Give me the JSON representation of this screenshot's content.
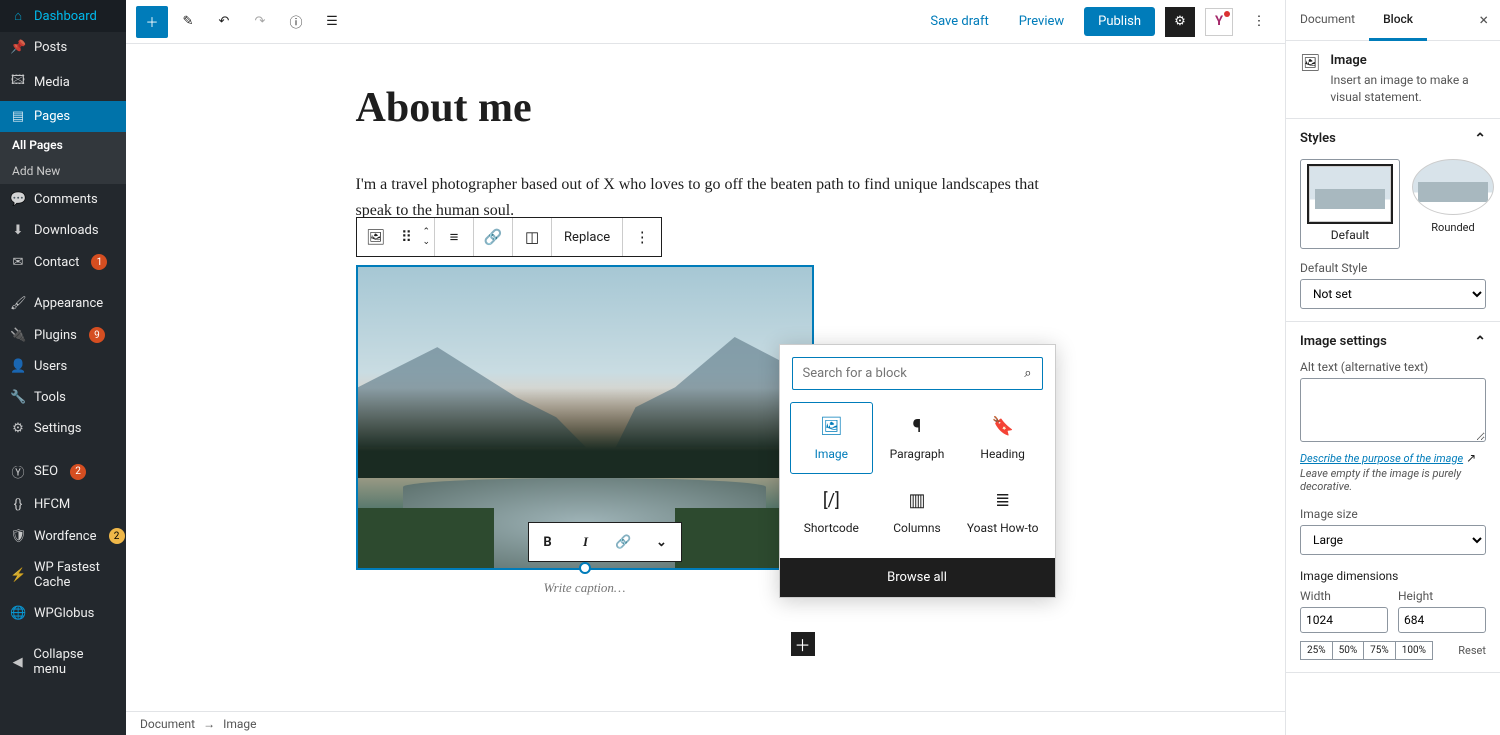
{
  "sidebar": {
    "items": [
      {
        "icon": "🏠",
        "label": "Dashboard"
      },
      {
        "icon": "📌",
        "label": "Posts"
      },
      {
        "icon": "🖼",
        "label": "Media"
      },
      {
        "icon": "📄",
        "label": "Pages",
        "active": true
      },
      {
        "icon": "💬",
        "label": "Comments"
      },
      {
        "icon": "⬇",
        "label": "Downloads"
      },
      {
        "icon": "✉",
        "label": "Contact",
        "badge": "1"
      },
      {
        "icon": "🎨",
        "label": "Appearance"
      },
      {
        "icon": "🔌",
        "label": "Plugins",
        "badge": "9"
      },
      {
        "icon": "👤",
        "label": "Users"
      },
      {
        "icon": "🔧",
        "label": "Tools"
      },
      {
        "icon": "⚙",
        "label": "Settings"
      },
      {
        "icon": "🔍",
        "label": "SEO",
        "badge": "2"
      },
      {
        "icon": "{}",
        "label": "HFCM"
      },
      {
        "icon": "🛡",
        "label": "Wordfence",
        "badge": "2"
      },
      {
        "icon": "⚡",
        "label": "WP Fastest Cache"
      },
      {
        "icon": "🌐",
        "label": "WPGlobus"
      }
    ],
    "sub_all": "All Pages",
    "sub_add": "Add New",
    "collapse": "Collapse menu"
  },
  "toolbar": {
    "save_draft": "Save draft",
    "preview": "Preview",
    "publish": "Publish"
  },
  "page": {
    "title": "About me",
    "para1": "I'm a travel photographer based out of X who loves to go off the beaten path to find unique landscapes that speak to the human soul.",
    "caption_placeholder": "Write caption…"
  },
  "block_toolbar": {
    "replace": "Replace"
  },
  "inserter": {
    "search_placeholder": "Search for a block",
    "blocks": [
      {
        "icon": "🖼",
        "label": "Image",
        "sel": true
      },
      {
        "icon": "¶",
        "label": "Paragraph"
      },
      {
        "icon": "🔖",
        "label": "Heading"
      },
      {
        "icon": "[/]",
        "label": "Shortcode"
      },
      {
        "icon": "▥",
        "label": "Columns"
      },
      {
        "icon": "≡",
        "label": "Yoast How-to"
      }
    ],
    "browse": "Browse all"
  },
  "breadcrumb": {
    "doc": "Document",
    "arrow": "→",
    "block": "Image"
  },
  "settings": {
    "tab_doc": "Document",
    "tab_block": "Block",
    "type_title": "Image",
    "type_desc": "Insert an image to make a visual statement.",
    "styles_hdr": "Styles",
    "style_default": "Default",
    "style_rounded": "Rounded",
    "default_style_lbl": "Default Style",
    "default_style_val": "Not set",
    "img_settings_hdr": "Image settings",
    "alt_lbl": "Alt text (alternative text)",
    "alt_link": "Describe the purpose of the image",
    "alt_note": "Leave empty if the image is purely decorative.",
    "size_lbl": "Image size",
    "size_val": "Large",
    "dims_hdr": "Image dimensions",
    "width_lbl": "Width",
    "width_val": "1024",
    "height_lbl": "Height",
    "height_val": "684",
    "pcts": [
      "25%",
      "50%",
      "75%",
      "100%"
    ],
    "reset": "Reset"
  }
}
